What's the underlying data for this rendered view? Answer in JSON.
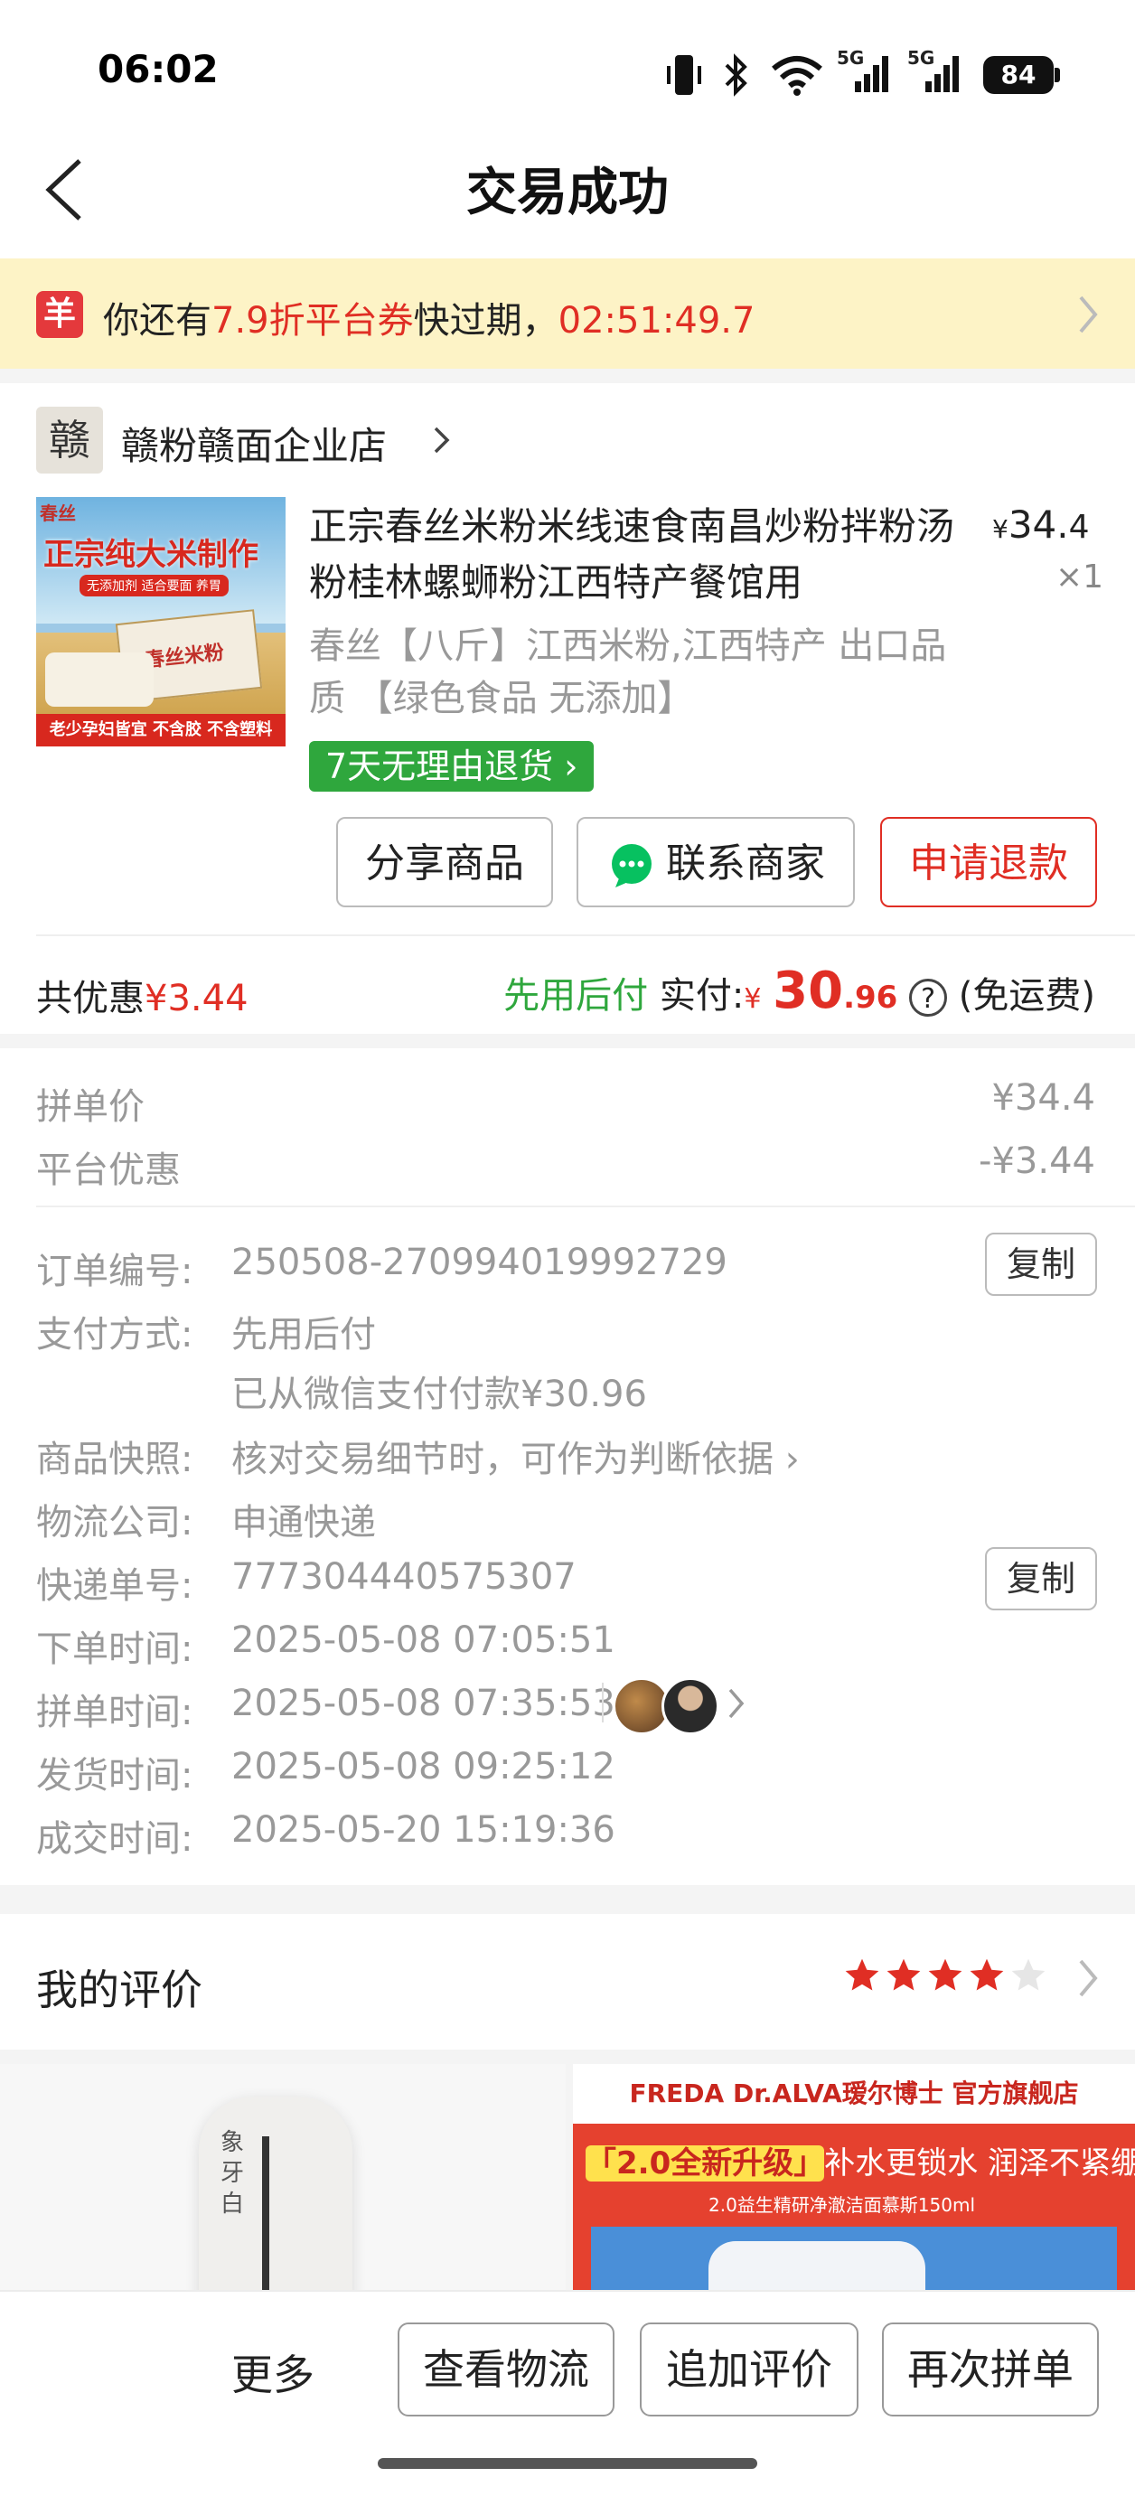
{
  "status": {
    "time": "06:02",
    "battery": "84",
    "network1": "5G",
    "network2": "5G"
  },
  "nav": {
    "title": "交易成功"
  },
  "coupon": {
    "icon_char": "羊",
    "prefix": "你还有",
    "discount": "7.9折平台券",
    "middle": "快过期，",
    "countdown": "02:51:49.7"
  },
  "shop": {
    "logo_char": "赣",
    "name": "赣粉赣面企业店"
  },
  "product": {
    "title": "正宗春丝米粉米线速食南昌炒粉拌粉汤粉桂林螺蛳粉江西特产餐馆用",
    "price_currency": "¥",
    "price_int": "34.",
    "price_dec": "4",
    "qty": "×1",
    "spec": "春丝【八斤】江西米粉,江西特产 出口品质 【绿色食品 无添加】",
    "return_tag": "7天无理由退货",
    "image_brand": "春丝",
    "image_headline": "正宗纯大米制作",
    "image_sub": "无添加剂 适合要面 养胃",
    "image_pack": "春丝米粉",
    "image_footer": "老少孕妇皆宜 不含胶 不含塑料"
  },
  "actions": {
    "share": "分享商品",
    "contact": "联系商家",
    "refund": "申请退款"
  },
  "summary": {
    "discount_label": "共优惠",
    "discount_value": "¥3.44",
    "pay_later": "先用后付",
    "paid_label": "实付:",
    "paid_currency": "¥",
    "paid_int": "30",
    "paid_dec": ".96",
    "help": "?",
    "shipping": "(免运费)"
  },
  "price_detail": {
    "group_price_label": "拼单价",
    "group_price_value": "¥34.4",
    "platform_discount_label": "平台优惠",
    "platform_discount_value": "-¥3.44"
  },
  "order": {
    "order_no_label": "订单编号:",
    "order_no": "250508-270994019992729",
    "copy_label": "复制",
    "pay_method_label": "支付方式:",
    "pay_method": "先用后付",
    "pay_note": "已从微信支付付款¥30.96",
    "snapshot_label": "商品快照:",
    "snapshot": "核对交易细节时，可作为判断依据",
    "courier_label": "物流公司:",
    "courier": "申通快递",
    "tracking_label": "快递单号:",
    "tracking_no": "777304440575307",
    "order_time_label": "下单时间:",
    "order_time": "2025-05-08 07:05:51",
    "group_time_label": "拼单时间:",
    "group_time": "2025-05-08 07:35:53",
    "ship_time_label": "发货时间:",
    "ship_time": "2025-05-08 09:25:12",
    "deal_time_label": "成交时间:",
    "deal_time": "2025-05-20 15:19:36"
  },
  "review": {
    "label": "我的评价",
    "rating": 4,
    "max": 5
  },
  "ads": {
    "left_text": "象牙白",
    "right_header": "FREDA  Dr.ALVA瑷尔博士  官方旗舰店",
    "right_tag": "「2.0全新升级」",
    "right_slogan": "补水更锁水 润泽不紧绷",
    "right_sub": "2.0益生精研净澈洁面慕斯150ml"
  },
  "bottom": {
    "more": "更多",
    "logistics": "查看物流",
    "add_review": "追加评价",
    "rebuy": "再次拼单"
  },
  "colors": {
    "accent": "#e02e24",
    "green": "#2fa73d",
    "banner": "#fdf3c6"
  }
}
